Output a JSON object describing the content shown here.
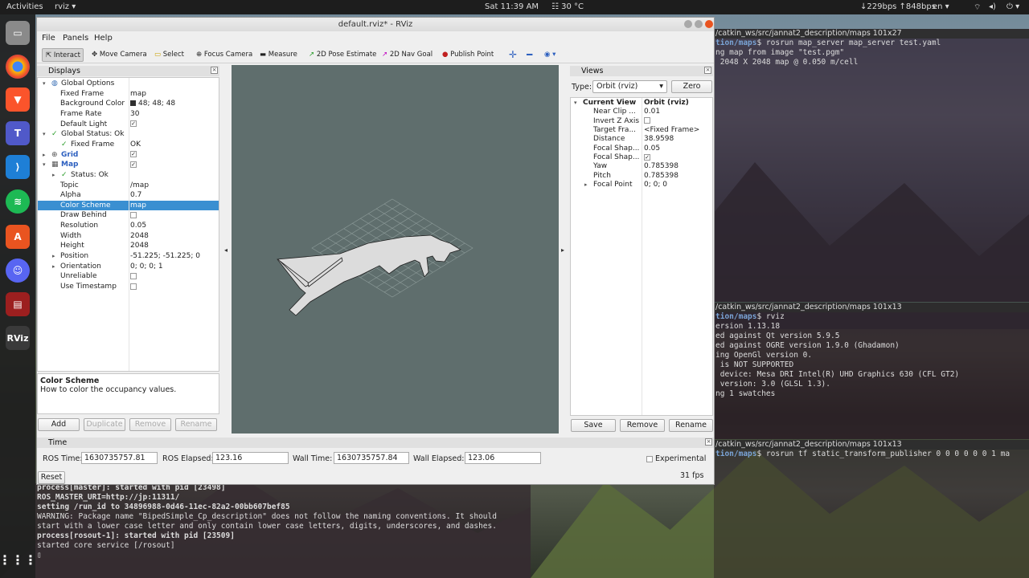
{
  "topbar": {
    "activities": "Activities",
    "app": "rviz",
    "clock": "Sat 11:39 AM",
    "temp": "30 °C",
    "net": "↓229bps ↑848bps",
    "lang": "en"
  },
  "dock": [
    "Files",
    "Chrome",
    "Brave",
    "Teams",
    "VS Code",
    "Spotify",
    "Software",
    "Discord",
    "Terminal",
    "RViz"
  ],
  "terminals": {
    "t1": {
      "title": "/catkin_ws/src/jannat2_description/maps 101x27",
      "lines": [
        {
          "p": "tion/maps",
          "t": "$ rosrun map_server map_server test.yaml"
        },
        {
          "p": "",
          "t": "ng map from image \"test.pgm\""
        },
        {
          "p": "",
          "t": " 2048 X 2048 map @ 0.050 m/cell"
        }
      ]
    },
    "t2": {
      "title": "/catkin_ws/src/jannat2_description/maps 101x13",
      "lines": [
        {
          "p": "tion/maps",
          "t": "$ rviz"
        },
        {
          "p": "",
          "t": "ersion 1.13.18"
        },
        {
          "p": "",
          "t": "ed against Qt version 5.9.5"
        },
        {
          "p": "",
          "t": "ed against OGRE version 1.9.0 (Ghadamon)"
        },
        {
          "p": "",
          "t": "ing OpenGl version 0."
        },
        {
          "p": "",
          "t": " is NOT SUPPORTED"
        },
        {
          "p": "",
          "t": " device: Mesa DRI Intel(R) UHD Graphics 630 (CFL GT2)"
        },
        {
          "p": "",
          "t": " version: 3.0 (GLSL 1.3)."
        },
        {
          "p": "",
          "t": "ng 1 swatches"
        }
      ]
    },
    "t3": {
      "title": "/catkin_ws/src/jannat2_description/maps 101x13",
      "lines": [
        {
          "p": "tion/maps",
          "t": "$ rosrun tf static_transform_publisher 0 0 0 0 0 0 1 ma"
        }
      ]
    },
    "t4": {
      "lines": [
        "process[master]: started with pid [23498]",
        "ROS_MASTER_URI=http://jp:11311/",
        "",
        "setting /run_id to 34896988-0d46-11ec-82a2-00bb607bef85",
        "WARNING: Package name \"BipedSimple_Cp_description\" does not follow the naming conventions. It should",
        "start with a lower case letter and only contain lower case letters, digits, underscores, and dashes.",
        "process[rosout-1]: started with pid [23509]",
        "started core service [/rosout]",
        "▯"
      ]
    }
  },
  "rviz": {
    "title": "default.rviz* - RViz",
    "menu": [
      "File",
      "Panels",
      "Help"
    ],
    "tools": [
      "Interact",
      "Move Camera",
      "Select",
      "Focus Camera",
      "Measure",
      "2D Pose Estimate",
      "2D Nav Goal",
      "Publish Point"
    ],
    "displays_title": "Displays",
    "displays": [
      {
        "k": "Global Options",
        "v": "",
        "indent": 0,
        "exp": "▾",
        "icon": "globe"
      },
      {
        "k": "Fixed Frame",
        "v": "map",
        "indent": 1
      },
      {
        "k": "Background Color",
        "v": "48; 48; 48",
        "indent": 1,
        "swatch": "#303030"
      },
      {
        "k": "Frame Rate",
        "v": "30",
        "indent": 1
      },
      {
        "k": "Default Light",
        "v": "",
        "indent": 1,
        "check": true
      },
      {
        "k": "Global Status: Ok",
        "v": "",
        "indent": 0,
        "exp": "▾",
        "icon": "tick"
      },
      {
        "k": "Fixed Frame",
        "v": "OK",
        "indent": 1,
        "icon": "tick"
      },
      {
        "k": "Grid",
        "v": "",
        "indent": 0,
        "exp": "▸",
        "icon": "grid",
        "check": true,
        "blue": true
      },
      {
        "k": "Map",
        "v": "",
        "indent": 0,
        "exp": "▾",
        "icon": "map",
        "check": true,
        "blue": true
      },
      {
        "k": "Status: Ok",
        "v": "",
        "indent": 1,
        "exp": "▸",
        "icon": "tick"
      },
      {
        "k": "Topic",
        "v": "/map",
        "indent": 1
      },
      {
        "k": "Alpha",
        "v": "0.7",
        "indent": 1
      },
      {
        "k": "Color Scheme",
        "v": "map",
        "indent": 1,
        "sel": true
      },
      {
        "k": "Draw Behind",
        "v": "",
        "indent": 1,
        "check": false
      },
      {
        "k": "Resolution",
        "v": "0.05",
        "indent": 1
      },
      {
        "k": "Width",
        "v": "2048",
        "indent": 1
      },
      {
        "k": "Height",
        "v": "2048",
        "indent": 1
      },
      {
        "k": "Position",
        "v": "-51.225; -51.225; 0",
        "indent": 1,
        "exp": "▸"
      },
      {
        "k": "Orientation",
        "v": "0; 0; 0; 1",
        "indent": 1,
        "exp": "▸"
      },
      {
        "k": "Unreliable",
        "v": "",
        "indent": 1,
        "check": false
      },
      {
        "k": "Use Timestamp",
        "v": "",
        "indent": 1,
        "check": false
      }
    ],
    "desc_title": "Color Scheme",
    "desc_text": "How to color the occupancy values.",
    "display_buttons": {
      "add": "Add",
      "duplicate": "Duplicate",
      "remove": "Remove",
      "rename": "Rename"
    },
    "views_title": "Views",
    "type_label": "Type:",
    "type_value": "Orbit (rviz)",
    "zero": "Zero",
    "views": [
      {
        "k": "Current View",
        "v": "Orbit (rviz)",
        "bold": true,
        "exp": "▾"
      },
      {
        "k": "Near Clip ...",
        "v": "0.01"
      },
      {
        "k": "Invert Z Axis",
        "v": "",
        "check": false
      },
      {
        "k": "Target Fra...",
        "v": "<Fixed Frame>"
      },
      {
        "k": "Distance",
        "v": "38.9598"
      },
      {
        "k": "Focal Shap...",
        "v": "0.05"
      },
      {
        "k": "Focal Shap...",
        "v": "",
        "check": true
      },
      {
        "k": "Yaw",
        "v": "0.785398"
      },
      {
        "k": "Pitch",
        "v": "0.785398"
      },
      {
        "k": "Focal Point",
        "v": "0; 0; 0",
        "exp": "▸"
      }
    ],
    "views_buttons": {
      "save": "Save",
      "remove": "Remove",
      "rename": "Rename"
    },
    "time_title": "Time",
    "ros_time_label": "ROS Time:",
    "ros_time": "1630735757.81",
    "ros_elapsed_label": "ROS Elapsed:",
    "ros_elapsed": "123.16",
    "wall_time_label": "Wall Time:",
    "wall_time": "1630735757.84",
    "wall_elapsed_label": "Wall Elapsed:",
    "wall_elapsed": "123.06",
    "experimental": "Experimental",
    "reset": "Reset",
    "fps": "31 fps"
  }
}
